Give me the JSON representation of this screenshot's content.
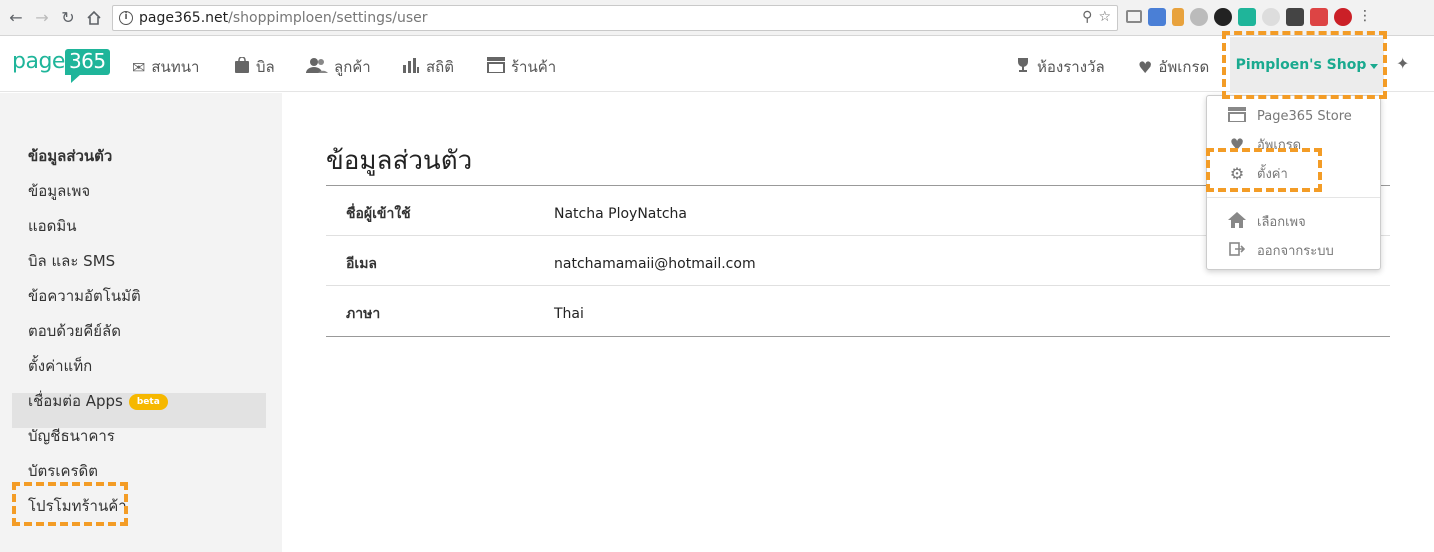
{
  "browser": {
    "url_host": "page365.net",
    "url_path": "/shoppimploen/settings/user"
  },
  "header": {
    "logo_text": "page",
    "logo_num": "365",
    "nav": [
      {
        "label": "สนทนา",
        "icon": "mail-icon"
      },
      {
        "label": "บิล",
        "icon": "bag-icon"
      },
      {
        "label": "ลูกค้า",
        "icon": "users-icon"
      },
      {
        "label": "สถิติ",
        "icon": "bar-chart-icon"
      },
      {
        "label": "ร้านค้า",
        "icon": "store-icon"
      }
    ],
    "awards_label": "ห้องรางวัล",
    "upgrade_label": "อัพเกรด",
    "shop_name": "Pimploen's Shop"
  },
  "sidebar": {
    "items": [
      {
        "label": "ข้อมูลส่วนตัว"
      },
      {
        "label": "ข้อมูลเพจ"
      },
      {
        "label": "แอดมิน"
      },
      {
        "label": "บิล และ SMS"
      },
      {
        "label": "ข้อความอัตโนมัติ"
      },
      {
        "label": "ตอบด้วยคีย์ลัด"
      },
      {
        "label": "ตั้งค่าแท็ก"
      },
      {
        "label": "เชื่อมต่อ Apps",
        "badge": "beta"
      },
      {
        "label": "บัญชีธนาคาร"
      },
      {
        "label": "บัตรเครดิต"
      },
      {
        "label": "โปรโมทร้านค้า"
      }
    ]
  },
  "main": {
    "title": "ข้อมูลส่วนตัว",
    "rows": [
      {
        "key": "ชื่อผู้เข้าใช้",
        "value": "Natcha PloyNatcha"
      },
      {
        "key": "อีเมล",
        "value": "natchamamaii@hotmail.com"
      },
      {
        "key": "ภาษา",
        "value": "Thai"
      }
    ]
  },
  "dropdown": {
    "items": [
      {
        "label": "Page365 Store",
        "icon": "store-icon"
      },
      {
        "label": "อัพเกรด",
        "icon": "heart-icon"
      },
      {
        "label": "ตั้งค่า",
        "icon": "gear-icon"
      },
      {
        "label": "เลือกเพจ",
        "icon": "home-icon"
      },
      {
        "label": "ออกจากระบบ",
        "icon": "logout-icon"
      }
    ]
  },
  "colors": {
    "brand": "#1fb59a",
    "annotation": "#f39c26",
    "beta_badge": "#f6b800"
  }
}
